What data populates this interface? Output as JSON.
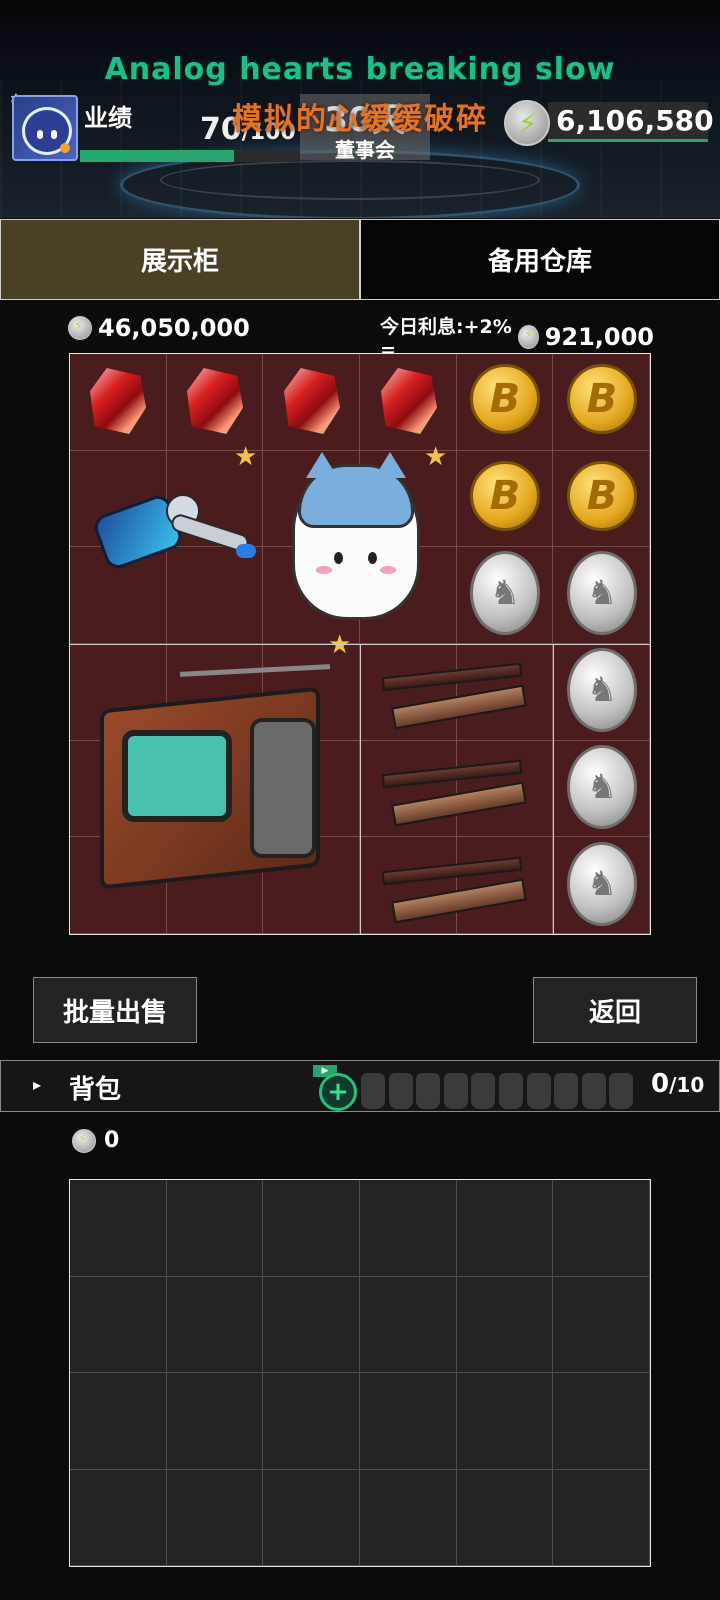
{
  "overlay": {
    "song_title": "Analog hearts breaking slow",
    "song_subtitle": "模拟的心缓缓破碎"
  },
  "header": {
    "performance_label": "业绩",
    "performance_value": "70",
    "performance_max": "/100",
    "performance_progress": 0.7,
    "board_days": "30天",
    "board_label": "董事会",
    "energy_value": "6,106,580"
  },
  "tabs": [
    {
      "label": "展示柜",
      "active": true
    },
    {
      "label": "备用仓库",
      "active": false
    }
  ],
  "showcase": {
    "total_value": "46,050,000",
    "interest_label": "今日利息:+2% =",
    "interest_value": "921,000",
    "items": [
      {
        "name": "red-crystal"
      },
      {
        "name": "red-crystal"
      },
      {
        "name": "red-crystal"
      },
      {
        "name": "red-crystal"
      },
      {
        "name": "gold-coin",
        "glyph": "B"
      },
      {
        "name": "gold-coin",
        "glyph": "B"
      },
      {
        "name": "gold-coin",
        "glyph": "B"
      },
      {
        "name": "gold-coin",
        "glyph": "B"
      },
      {
        "name": "silver-coin",
        "glyph": "♞"
      },
      {
        "name": "silver-coin",
        "glyph": "♞"
      },
      {
        "name": "silver-coin",
        "glyph": "♞"
      },
      {
        "name": "silver-coin",
        "glyph": "♞"
      },
      {
        "name": "silver-coin",
        "glyph": "♞"
      },
      {
        "name": "robot"
      },
      {
        "name": "blue-cat"
      },
      {
        "name": "retro-tv"
      },
      {
        "name": "wooden-stick"
      },
      {
        "name": "wooden-stick"
      },
      {
        "name": "wooden-stick"
      }
    ],
    "star_glyph": "★"
  },
  "buttons": {
    "bulk_sell": "批量出售",
    "back": "返回"
  },
  "backpack": {
    "arrow": "▸",
    "label": "背包",
    "add_glyph": "+",
    "flag_glyph": "▶",
    "slots_total": 10,
    "count": "0",
    "capacity": "/10",
    "value": "0"
  },
  "colors": {
    "accent_green": "#27a56e",
    "showcase_bg": "#4a1c1d",
    "active_tab": "#4a4025",
    "title_green": "#1bbf8a",
    "subtitle_orange": "#e0742b"
  }
}
